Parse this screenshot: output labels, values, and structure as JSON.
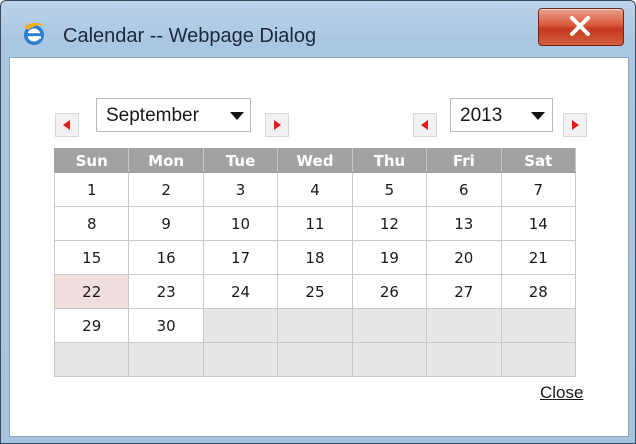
{
  "window": {
    "title": "Calendar -- Webpage Dialog",
    "close_glyph": "x"
  },
  "month": {
    "prev_icon": "red-left-triangle",
    "selected": "September",
    "next_icon": "red-right-triangle"
  },
  "year": {
    "prev_icon": "red-left-triangle",
    "selected": "2013",
    "next_icon": "red-right-triangle"
  },
  "calendar": {
    "weekdays": [
      "Sun",
      "Mon",
      "Tue",
      "Wed",
      "Thu",
      "Fri",
      "Sat"
    ],
    "weeks": [
      [
        "1",
        "2",
        "3",
        "4",
        "5",
        "6",
        "7"
      ],
      [
        "8",
        "9",
        "10",
        "11",
        "12",
        "13",
        "14"
      ],
      [
        "15",
        "16",
        "17",
        "18",
        "19",
        "20",
        "21"
      ],
      [
        "22",
        "23",
        "24",
        "25",
        "26",
        "27",
        "28"
      ],
      [
        "29",
        "30",
        "",
        "",
        "",
        "",
        ""
      ],
      [
        "",
        "",
        "",
        "",
        "",
        "",
        ""
      ]
    ],
    "highlighted_day": "22"
  },
  "footer": {
    "close_label": "Close"
  },
  "colors": {
    "nav_arrow": "#e31b1b",
    "header_bg": "#a2a2a2",
    "highlight_bg": "#f1dede",
    "empty_cell_bg": "#e7e7e7"
  }
}
